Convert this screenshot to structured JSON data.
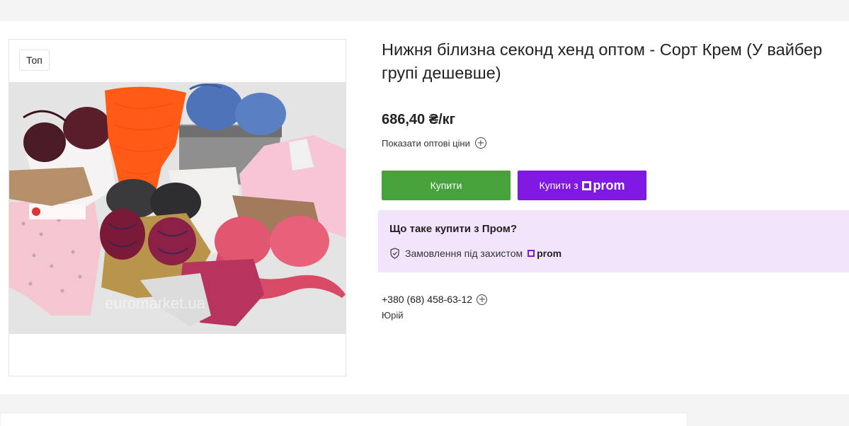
{
  "product": {
    "badge": "Топ",
    "title": "Нижня білизна секонд хенд оптом - Сорт Крем (У вайбер групі дешевше)",
    "price": "686,40 ₴/кг",
    "wholesale_label": "Показати оптові ціни",
    "watermark": "euromarket.ua"
  },
  "actions": {
    "buy_label": "Купити",
    "buy_with_label": "Купити з",
    "prom_brand": "prom"
  },
  "prom_info": {
    "title": "Що таке купити з Пром?",
    "protection_label": "Замовлення під захистом",
    "brand": "prom"
  },
  "contact": {
    "phone": "+380 (68) 458-63-12",
    "name": "Юрій"
  },
  "colors": {
    "buy_green": "#46a33c",
    "prom_purple": "#7f18e2",
    "info_bg": "#f1e4fb"
  },
  "icons": {
    "expand": "plus-circle-icon",
    "shield": "shield-icon"
  }
}
